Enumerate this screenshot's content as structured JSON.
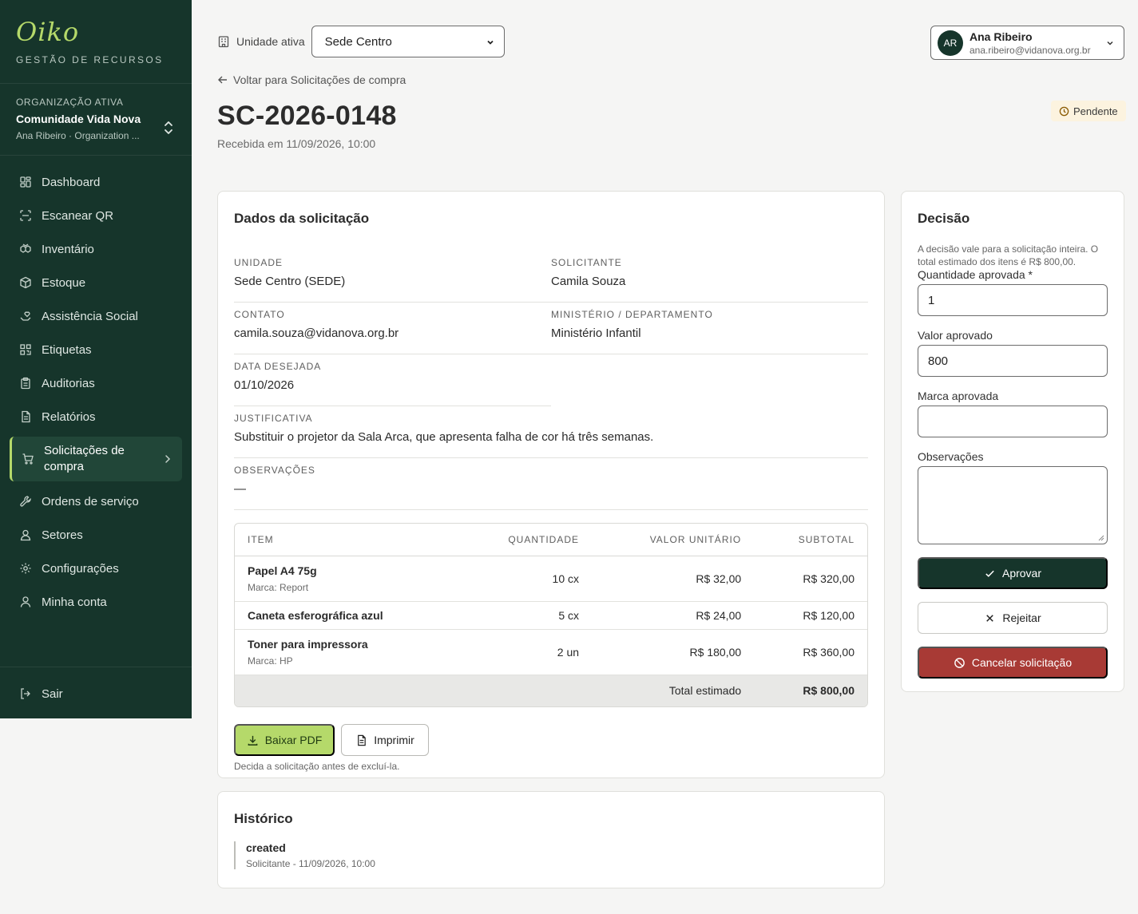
{
  "brand": {
    "logo": "Oiko",
    "subtitle": "GESTÃO DE RECURSOS"
  },
  "org": {
    "label": "ORGANIZAÇÃO ATIVA",
    "name": "Comunidade Vida Nova",
    "user": "Ana Ribeiro · Organization ..."
  },
  "nav": [
    {
      "label": "Dashboard",
      "icon": "dashboard-icon"
    },
    {
      "label": "Escanear QR",
      "icon": "scan-qr-icon"
    },
    {
      "label": "Inventário",
      "icon": "inventory-icon"
    },
    {
      "label": "Estoque",
      "icon": "box-icon"
    },
    {
      "label": "Assistência Social",
      "icon": "hand-heart-icon"
    },
    {
      "label": "Etiquetas",
      "icon": "qr-code-icon"
    },
    {
      "label": "Auditorias",
      "icon": "clipboard-icon"
    },
    {
      "label": "Relatórios",
      "icon": "report-icon"
    },
    {
      "label": "Solicitações de compra",
      "icon": "cart-icon",
      "active": true
    },
    {
      "label": "Ordens de serviço",
      "icon": "wrench-icon"
    },
    {
      "label": "Setores",
      "icon": "sector-icon"
    },
    {
      "label": "Configurações",
      "icon": "gear-icon"
    },
    {
      "label": "Minha conta",
      "icon": "user-icon"
    }
  ],
  "logout": "Sair",
  "topbar": {
    "unit_label": "Unidade ativa",
    "unit_value": "Sede Centro"
  },
  "user": {
    "initials": "AR",
    "name": "Ana Ribeiro",
    "email": "ana.ribeiro@vidanova.org.br"
  },
  "header": {
    "back": "Voltar para Solicitações de compra",
    "title": "SC-2026-0148",
    "received": "Recebida em 11/09/2026, 10:00",
    "status": "Pendente"
  },
  "details": {
    "title": "Dados da solicitação",
    "unidade_label": "UNIDADE",
    "unidade": "Sede Centro (SEDE)",
    "solicitante_label": "SOLICITANTE",
    "solicitante": "Camila Souza",
    "contato_label": "CONTATO",
    "contato": "camila.souza@vidanova.org.br",
    "ministerio_label": "MINISTÉRIO / DEPARTAMENTO",
    "ministerio": "Ministério Infantil",
    "data_label": "DATA DESEJADA",
    "data": "01/10/2026",
    "justificativa_label": "JUSTIFICATIVA",
    "justificativa": "Substituir o projetor da Sala Arca, que apresenta falha de cor há três semanas.",
    "observacoes_label": "OBSERVAÇÕES",
    "observacoes": "—"
  },
  "items": {
    "headers": [
      "ITEM",
      "QUANTIDADE",
      "VALOR UNITÁRIO",
      "SUBTOTAL"
    ],
    "rows": [
      {
        "name": "Papel A4 75g",
        "brand": "Marca: Report",
        "qty": "10 cx",
        "unit": "R$ 32,00",
        "subtotal": "R$ 320,00"
      },
      {
        "name": "Caneta esferográfica azul",
        "brand": "",
        "qty": "5 cx",
        "unit": "R$ 24,00",
        "subtotal": "R$ 120,00"
      },
      {
        "name": "Toner para impressora",
        "brand": "Marca: HP",
        "qty": "2 un",
        "unit": "R$ 180,00",
        "subtotal": "R$ 360,00"
      }
    ],
    "total_label": "Total estimado",
    "total": "R$ 800,00"
  },
  "actions": {
    "pdf": "Baixar PDF",
    "print": "Imprimir",
    "hint": "Decida a solicitação antes de excluí-la."
  },
  "history": {
    "title": "Histórico",
    "entries": [
      {
        "title": "created",
        "meta": "Solicitante - 11/09/2026, 10:00"
      }
    ]
  },
  "decision": {
    "title": "Decisão",
    "note": "A decisão vale para a solicitação inteira. O total estimado dos itens é R$ 800,00.",
    "qty_label": "Quantidade aprovada *",
    "qty_value": "1",
    "value_label": "Valor aprovado",
    "value_value": "800",
    "brand_label": "Marca aprovada",
    "brand_value": "",
    "obs_label": "Observações",
    "obs_value": "",
    "approve": "Aprovar",
    "reject": "Rejeitar",
    "cancel": "Cancelar solicitação"
  },
  "colors": {
    "sidebar": "#16352b",
    "accent": "#b5d96a",
    "danger": "#a83a35",
    "pending_badge": "#fcf3df"
  }
}
